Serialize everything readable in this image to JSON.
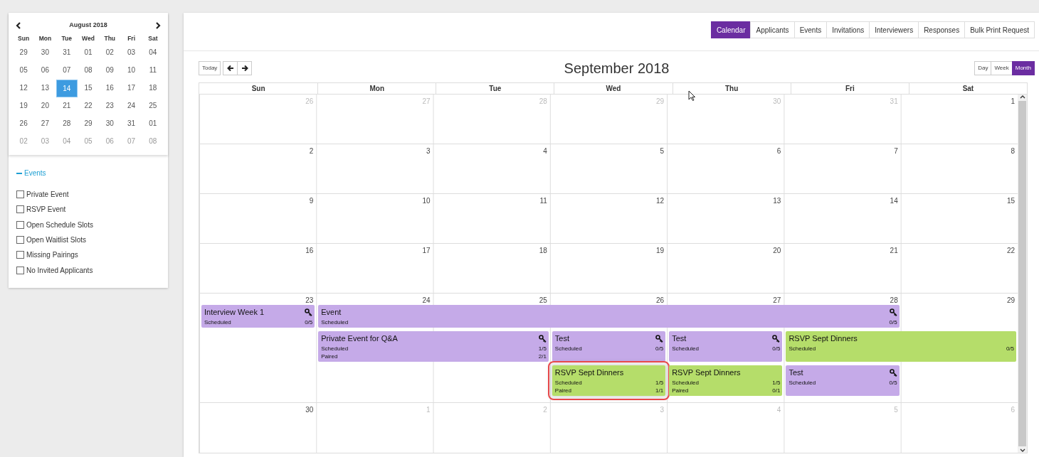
{
  "mini_calendar": {
    "title": "August 2018",
    "weekdays": [
      "Sun",
      "Mon",
      "Tue",
      "Wed",
      "Thu",
      "Fri",
      "Sat"
    ],
    "weeks": [
      [
        {
          "day": "29",
          "selected": false,
          "muted": false
        },
        {
          "day": "30",
          "selected": false,
          "muted": false
        },
        {
          "day": "31",
          "selected": false,
          "muted": false
        },
        {
          "day": "01",
          "selected": false,
          "muted": false
        },
        {
          "day": "02",
          "selected": false,
          "muted": false
        },
        {
          "day": "03",
          "selected": false,
          "muted": false
        },
        {
          "day": "04",
          "selected": false,
          "muted": false
        }
      ],
      [
        {
          "day": "05",
          "selected": false,
          "muted": false
        },
        {
          "day": "06",
          "selected": false,
          "muted": false
        },
        {
          "day": "07",
          "selected": false,
          "muted": false
        },
        {
          "day": "08",
          "selected": false,
          "muted": false
        },
        {
          "day": "09",
          "selected": false,
          "muted": false
        },
        {
          "day": "10",
          "selected": false,
          "muted": false
        },
        {
          "day": "11",
          "selected": false,
          "muted": false
        }
      ],
      [
        {
          "day": "12",
          "selected": false,
          "muted": false
        },
        {
          "day": "13",
          "selected": false,
          "muted": false
        },
        {
          "day": "14",
          "selected": true,
          "muted": false
        },
        {
          "day": "15",
          "selected": false,
          "muted": false
        },
        {
          "day": "16",
          "selected": false,
          "muted": false
        },
        {
          "day": "17",
          "selected": false,
          "muted": false
        },
        {
          "day": "18",
          "selected": false,
          "muted": false
        }
      ],
      [
        {
          "day": "19",
          "selected": false,
          "muted": false
        },
        {
          "day": "20",
          "selected": false,
          "muted": false
        },
        {
          "day": "21",
          "selected": false,
          "muted": false
        },
        {
          "day": "22",
          "selected": false,
          "muted": false
        },
        {
          "day": "23",
          "selected": false,
          "muted": false
        },
        {
          "day": "24",
          "selected": false,
          "muted": false
        },
        {
          "day": "25",
          "selected": false,
          "muted": false
        }
      ],
      [
        {
          "day": "26",
          "selected": false,
          "muted": false
        },
        {
          "day": "27",
          "selected": false,
          "muted": false
        },
        {
          "day": "28",
          "selected": false,
          "muted": false
        },
        {
          "day": "29",
          "selected": false,
          "muted": false
        },
        {
          "day": "30",
          "selected": false,
          "muted": false
        },
        {
          "day": "31",
          "selected": false,
          "muted": false
        },
        {
          "day": "01",
          "selected": false,
          "muted": false
        }
      ],
      [
        {
          "day": "02",
          "selected": false,
          "muted": true
        },
        {
          "day": "03",
          "selected": false,
          "muted": true
        },
        {
          "day": "04",
          "selected": false,
          "muted": true
        },
        {
          "day": "05",
          "selected": false,
          "muted": true
        },
        {
          "day": "06",
          "selected": false,
          "muted": true
        },
        {
          "day": "07",
          "selected": false,
          "muted": true
        },
        {
          "day": "08",
          "selected": false,
          "muted": true
        }
      ]
    ]
  },
  "filters": {
    "title": "Events",
    "expanded": true,
    "items": [
      {
        "label": "Private Event",
        "checked": false
      },
      {
        "label": "RSVP Event",
        "checked": false
      },
      {
        "label": "Open Schedule Slots",
        "checked": false
      },
      {
        "label": "Open Waitlist Slots",
        "checked": false
      },
      {
        "label": "Missing Pairings",
        "checked": false
      },
      {
        "label": "No Invited Applicants",
        "checked": false
      }
    ]
  },
  "tabs": [
    {
      "label": "Calendar",
      "selected": true
    },
    {
      "label": "Applicants",
      "selected": false
    },
    {
      "label": "Events",
      "selected": false
    },
    {
      "label": "Invitations",
      "selected": false
    },
    {
      "label": "Interviewers",
      "selected": false
    },
    {
      "label": "Responses",
      "selected": false
    },
    {
      "label": "Bulk Print Request",
      "selected": false
    }
  ],
  "toolbar": {
    "today": "Today",
    "title": "September 2018",
    "views": [
      {
        "label": "Day",
        "selected": false
      },
      {
        "label": "Week",
        "selected": false
      },
      {
        "label": "Month",
        "selected": true
      }
    ]
  },
  "calendar": {
    "weekdays": [
      "Sun",
      "Mon",
      "Tue",
      "Wed",
      "Thu",
      "Fri",
      "Sat"
    ],
    "weeks": [
      {
        "days": [
          {
            "day": "26",
            "muted": true
          },
          {
            "day": "27",
            "muted": true
          },
          {
            "day": "28",
            "muted": true
          },
          {
            "day": "29",
            "muted": true
          },
          {
            "day": "30",
            "muted": true
          },
          {
            "day": "31",
            "muted": true
          },
          {
            "day": "1",
            "muted": false
          }
        ]
      },
      {
        "days": [
          {
            "day": "2",
            "muted": false
          },
          {
            "day": "3",
            "muted": false
          },
          {
            "day": "4",
            "muted": false
          },
          {
            "day": "5",
            "muted": false
          },
          {
            "day": "6",
            "muted": false
          },
          {
            "day": "7",
            "muted": false
          },
          {
            "day": "8",
            "muted": false
          }
        ]
      },
      {
        "days": [
          {
            "day": "9",
            "muted": false
          },
          {
            "day": "10",
            "muted": false
          },
          {
            "day": "11",
            "muted": false
          },
          {
            "day": "12",
            "muted": false
          },
          {
            "day": "13",
            "muted": false
          },
          {
            "day": "14",
            "muted": false
          },
          {
            "day": "15",
            "muted": false
          }
        ]
      },
      {
        "days": [
          {
            "day": "16",
            "muted": false
          },
          {
            "day": "17",
            "muted": false
          },
          {
            "day": "18",
            "muted": false
          },
          {
            "day": "19",
            "muted": false
          },
          {
            "day": "20",
            "muted": false
          },
          {
            "day": "21",
            "muted": false
          },
          {
            "day": "22",
            "muted": false
          }
        ]
      },
      {
        "days": [
          {
            "day": "23",
            "muted": false
          },
          {
            "day": "24",
            "muted": false
          },
          {
            "day": "25",
            "muted": false
          },
          {
            "day": "26",
            "muted": false
          },
          {
            "day": "27",
            "muted": false
          },
          {
            "day": "28",
            "muted": false
          },
          {
            "day": "29",
            "muted": false
          }
        ],
        "lanes": [
          [
            {
              "kind": "event",
              "title": "Interview Week 1",
              "color": "#c5aae8",
              "key": true,
              "highlighted": false,
              "rows": [
                {
                  "label": "Scheduled",
                  "value": "0/5"
                }
              ]
            },
            {
              "kind": "event",
              "title": "Event",
              "color": "#c5aae8",
              "key": true,
              "highlighted": false,
              "rows": [
                {
                  "label": "Scheduled",
                  "value": "0/5"
                }
              ]
            },
            {
              "kind": "continued"
            },
            {
              "kind": "continued"
            },
            {
              "kind": "continued"
            },
            {
              "kind": "continued"
            },
            {
              "kind": "empty"
            }
          ],
          [
            {
              "kind": "empty"
            },
            {
              "kind": "event",
              "title": "Private Event for Q&A",
              "color": "#c5aae8",
              "key": true,
              "highlighted": false,
              "rows": [
                {
                  "label": "Scheduled",
                  "value": "1/5"
                },
                {
                  "label": "Paired",
                  "value": "2/1"
                }
              ]
            },
            {
              "kind": "continued"
            },
            {
              "kind": "event",
              "title": "Test",
              "color": "#c5aae8",
              "key": true,
              "highlighted": false,
              "rows": [
                {
                  "label": "Scheduled",
                  "value": "0/5"
                }
              ]
            },
            {
              "kind": "event",
              "title": "Test",
              "color": "#c5aae8",
              "key": true,
              "highlighted": false,
              "rows": [
                {
                  "label": "Scheduled",
                  "value": "0/5"
                }
              ]
            },
            {
              "kind": "event",
              "title": "RSVP Sept Dinners",
              "color": "#b5dd6a",
              "key": false,
              "highlighted": false,
              "rows": [
                {
                  "label": "Scheduled",
                  "value": "0/5"
                }
              ]
            },
            {
              "kind": "continued"
            }
          ],
          [
            {
              "kind": "empty"
            },
            {
              "kind": "empty"
            },
            {
              "kind": "empty"
            },
            {
              "kind": "event",
              "title": "RSVP Sept Dinners",
              "color": "#b5dd6a",
              "key": false,
              "highlighted": true,
              "rows": [
                {
                  "label": "Scheduled",
                  "value": "1/5"
                },
                {
                  "label": "Paired",
                  "value": "1/1"
                }
              ]
            },
            {
              "kind": "event",
              "title": "RSVP Sept Dinners",
              "color": "#b5dd6a",
              "key": false,
              "highlighted": false,
              "rows": [
                {
                  "label": "Scheduled",
                  "value": "1/5"
                },
                {
                  "label": "Paired",
                  "value": "0/1"
                }
              ]
            },
            {
              "kind": "event",
              "title": "Test",
              "color": "#c5aae8",
              "key": true,
              "highlighted": false,
              "rows": [
                {
                  "label": "Scheduled",
                  "value": "0/5"
                }
              ]
            },
            {
              "kind": "empty"
            }
          ]
        ]
      },
      {
        "days": [
          {
            "day": "30",
            "muted": false
          },
          {
            "day": "1",
            "muted": true
          },
          {
            "day": "2",
            "muted": true
          },
          {
            "day": "3",
            "muted": true
          },
          {
            "day": "4",
            "muted": true
          },
          {
            "day": "5",
            "muted": true
          },
          {
            "day": "6",
            "muted": true
          }
        ]
      }
    ]
  }
}
